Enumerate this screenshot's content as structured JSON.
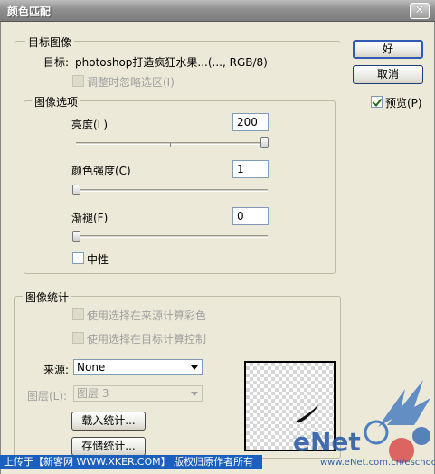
{
  "window": {
    "title": "颜色匹配",
    "close_glyph": "✕"
  },
  "target_image": {
    "group_label": "目标图像",
    "target_prefix": "目标:",
    "target_value": "photoshop打造疯狂水果...(..., RGB/8)",
    "ignore_selection_label": "调整时忽略选区(I)"
  },
  "image_options": {
    "group_label": "图像选项",
    "brightness_label": "亮度(L)",
    "brightness_value": "200",
    "brightness_level_pct": 100,
    "color_intensity_label": "颜色强度(C)",
    "color_intensity_value": "1",
    "color_intensity_level_pct": 0,
    "fade_label": "渐褪(F)",
    "fade_value": "0",
    "fade_level_pct": 0,
    "neutralize_label": "中性",
    "neutralize_checked": false
  },
  "image_statistics": {
    "group_label": "图像统计",
    "use_source_selection_label": "使用选择在来源计算彩色",
    "use_target_selection_label": "使用选择在目标计算控制",
    "source_label": "来源:",
    "source_value": "None",
    "layer_label": "图层(L):",
    "layer_value": "图层 3",
    "load_stats_label": "载入统计...",
    "save_stats_label": "存储统计..."
  },
  "buttons": {
    "ok": "好",
    "cancel": "取消"
  },
  "preview": {
    "label": "预览(P)",
    "checked": true
  },
  "footer": {
    "text": "上传于【新客网 WWW.XKER.COM】 版权归原作者所有"
  },
  "watermark": {
    "text": "eNet",
    "subtext": "www.eNet.com.cn/eschool"
  },
  "colors": {
    "accent": "#2f59b3",
    "footer_bg": "#1b5fbf",
    "title_bar": "#8f8f8f"
  }
}
